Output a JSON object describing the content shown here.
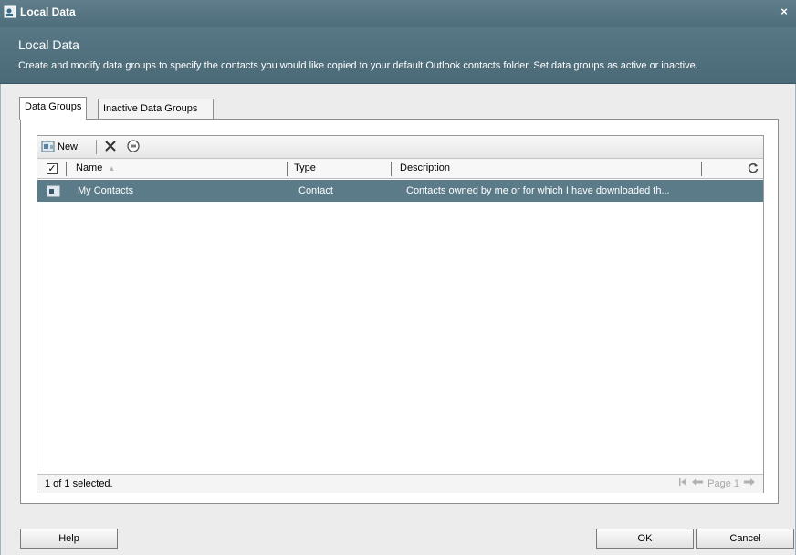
{
  "window": {
    "title": "Local Data",
    "close_glyph": "×"
  },
  "header": {
    "title": "Local Data",
    "description": "Create and modify data groups to specify the contacts you would like copied to your default Outlook contacts folder. Set data groups as active or inactive."
  },
  "tabs": [
    {
      "label": "Data Groups",
      "active": true
    },
    {
      "label": "Inactive Data Groups",
      "active": false
    }
  ],
  "toolbar": {
    "new_label": "New",
    "icons": {
      "new": "new-record-icon",
      "delete": "delete-icon",
      "status": "deactivate-icon"
    }
  },
  "grid": {
    "select_all_checked": true,
    "checkmark": "✓",
    "columns": [
      {
        "label": "Name",
        "sorted": "ascending"
      },
      {
        "label": "Type"
      },
      {
        "label": "Description"
      }
    ],
    "refresh_icon": "refresh-icon",
    "rows": [
      {
        "name": "My Contacts",
        "type": "Contact",
        "description": "Contacts owned by me or for which I have downloaded th...",
        "selected": true
      }
    ]
  },
  "status": {
    "selection": "1 of 1 selected.",
    "page": "Page 1"
  },
  "footer": {
    "help": "Help",
    "ok": "OK",
    "cancel": "Cancel"
  },
  "colors": {
    "header_bg": "#587785",
    "selected_row": "#5c7b89",
    "body_bg": "#ececec"
  }
}
